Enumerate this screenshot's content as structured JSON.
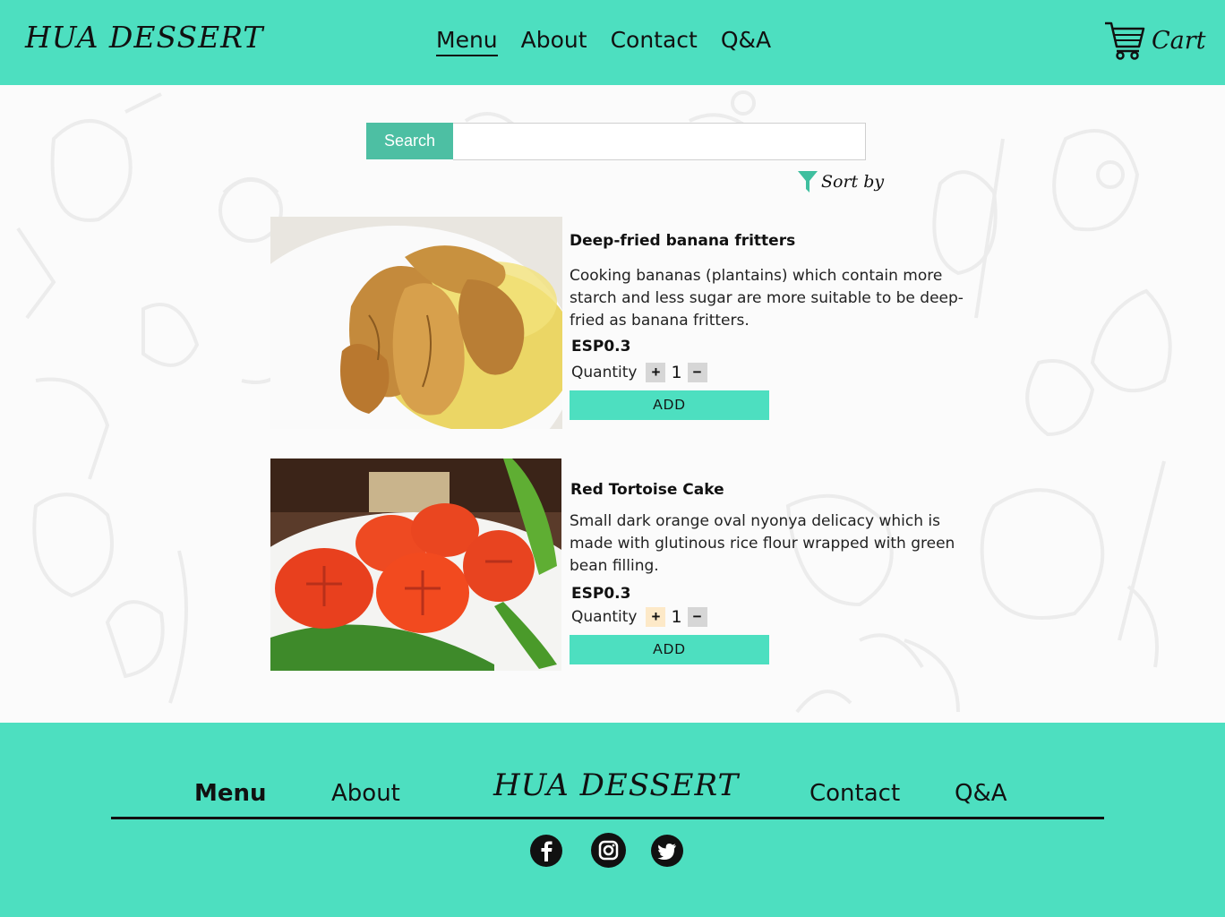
{
  "header": {
    "logo": "HUA DESSERT",
    "nav": [
      {
        "label": "Menu",
        "active": true
      },
      {
        "label": "About",
        "active": false
      },
      {
        "label": "Contact",
        "active": false
      },
      {
        "label": "Q&A",
        "active": false
      }
    ],
    "cart_label": "Cart"
  },
  "search": {
    "button_label": "Search",
    "value": "",
    "placeholder": ""
  },
  "sort": {
    "label": "Sort by"
  },
  "products": [
    {
      "name": "Deep-fried banana fritters",
      "description": "Cooking bananas (plantains) which contain more starch and less sugar are more suitable to be deep-fried as banana fritters.",
      "price": "ESP0.3",
      "quantity_label": "Quantity",
      "quantity": "1",
      "plus": "+",
      "minus": "−",
      "add_label": "ADD"
    },
    {
      "name": "Red Tortoise Cake",
      "description": "Small dark orange oval nyonya delicacy which is made with glutinous rice flour wrapped with green bean filling.",
      "price": "ESP0.3",
      "quantity_label": "Quantity",
      "quantity": "1",
      "plus": "+",
      "minus": "−",
      "add_label": "ADD"
    }
  ],
  "footer": {
    "links": [
      "Menu",
      "About",
      "Contact",
      "Q&A"
    ],
    "logo": "HUA DESSERT",
    "social": [
      "facebook-icon",
      "instagram-icon",
      "twitter-icon"
    ]
  },
  "colors": {
    "brand": "#4ddfc0",
    "search_button": "#4dbfa3",
    "filter_icon": "#3fbf9f"
  }
}
